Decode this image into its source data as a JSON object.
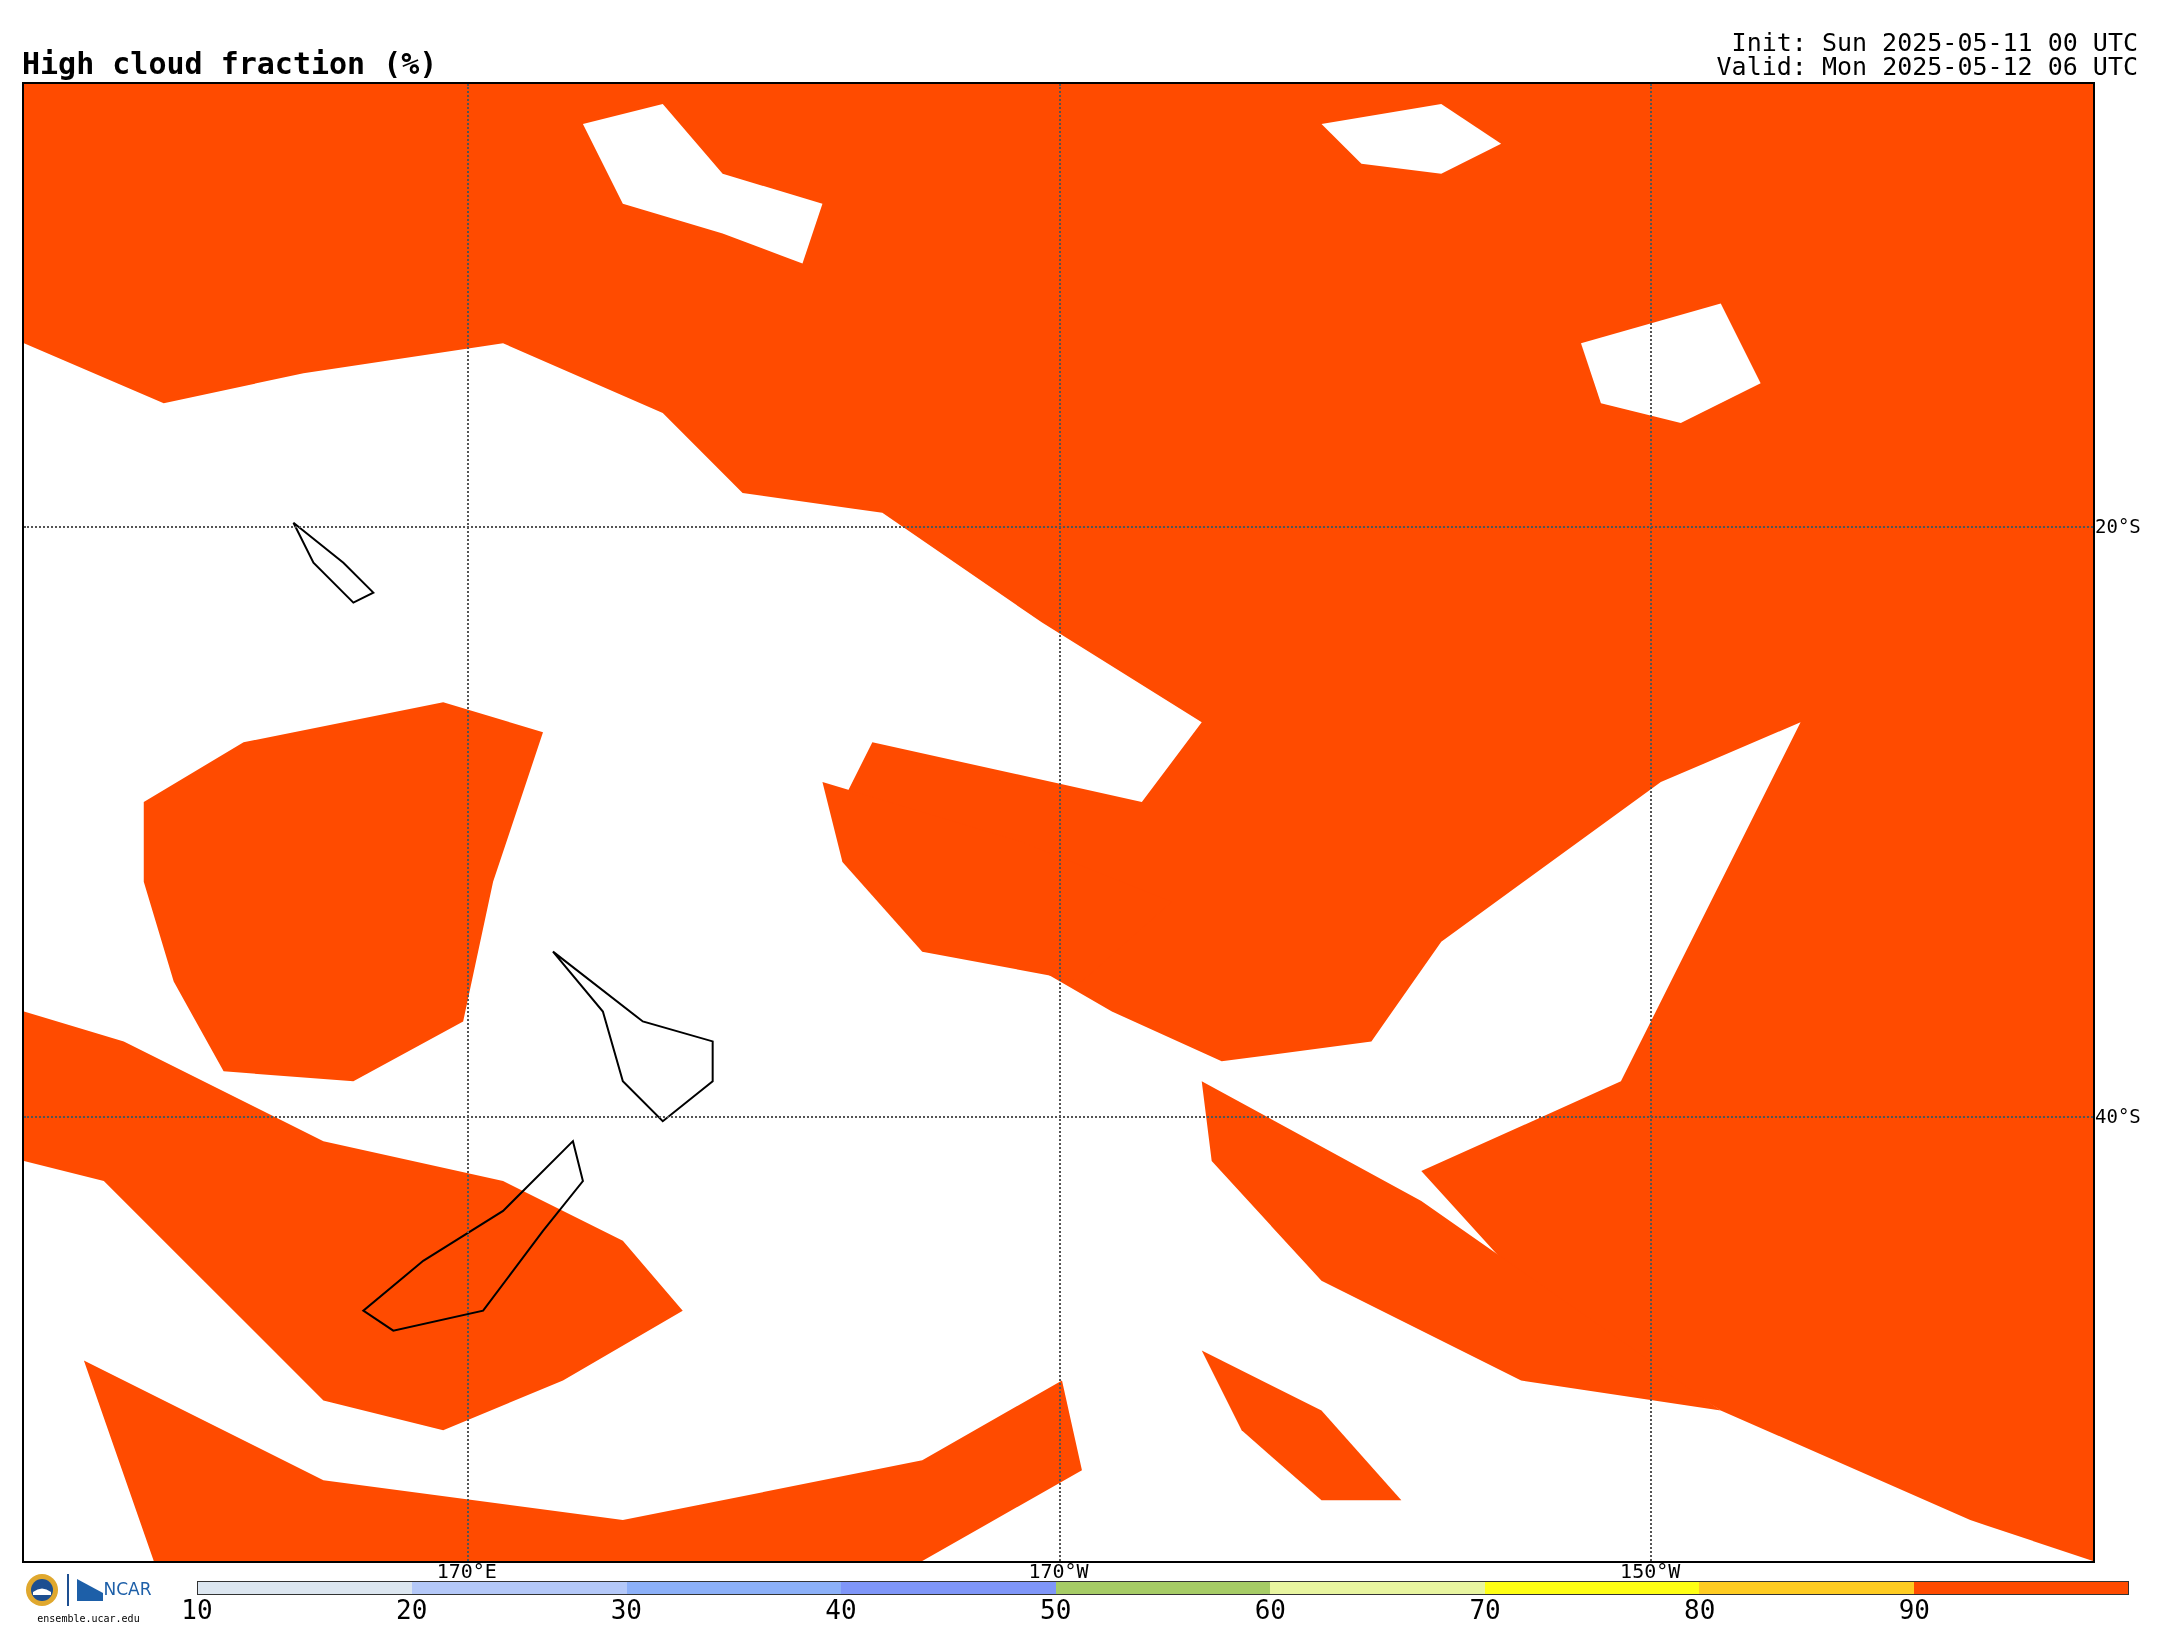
{
  "title": "High cloud fraction (%)",
  "run_info": [
    "Init: Sun 2025-05-11 00 UTC",
    "Valid: Mon 2025-05-12 06 UTC"
  ],
  "map": {
    "lon_labels": [
      "170°E",
      "170°W",
      "150°W"
    ],
    "lat_labels": [
      "20°S",
      "40°S"
    ]
  },
  "logo": {
    "name": "NCAR",
    "url": "ensemble.ucar.edu"
  },
  "colorbar": {
    "bins": [
      {
        "label": "10",
        "color": "#dce6f0"
      },
      {
        "label": "20",
        "color": "#b4c8f8"
      },
      {
        "label": "30",
        "color": "#8cb0f8"
      },
      {
        "label": "40",
        "color": "#7f96f8"
      },
      {
        "label": "50",
        "color": "#a6cc66"
      },
      {
        "label": "60",
        "color": "#e8f5a0"
      },
      {
        "label": "70",
        "color": "#ffff14"
      },
      {
        "label": "80",
        "color": "#ffcc22"
      },
      {
        "label": "90",
        "color": "#ff4b00"
      }
    ]
  }
}
